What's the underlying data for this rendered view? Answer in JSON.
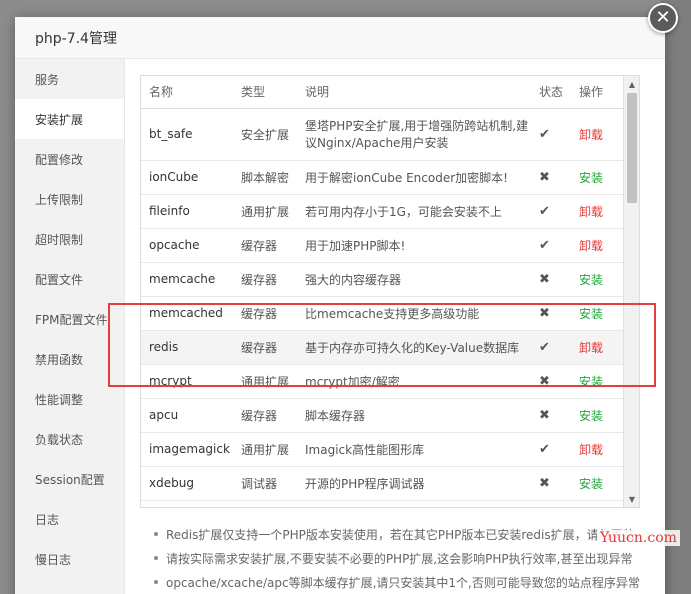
{
  "dialog": {
    "title": "php-7.4管理",
    "close_label": "✕"
  },
  "sidebar": {
    "items": [
      {
        "label": "服务"
      },
      {
        "label": "安装扩展"
      },
      {
        "label": "配置修改"
      },
      {
        "label": "上传限制"
      },
      {
        "label": "超时限制"
      },
      {
        "label": "配置文件"
      },
      {
        "label": "FPM配置文件"
      },
      {
        "label": "禁用函数"
      },
      {
        "label": "性能调整"
      },
      {
        "label": "负载状态"
      },
      {
        "label": "Session配置"
      },
      {
        "label": "日志"
      },
      {
        "label": "慢日志"
      }
    ],
    "active_index": 1
  },
  "table": {
    "headers": {
      "name": "名称",
      "type": "类型",
      "desc": "说明",
      "status": "状态",
      "action": "操作"
    },
    "rows": [
      {
        "name": "bt_safe",
        "type": "安全扩展",
        "desc": "堡塔PHP安全扩展,用于增强防跨站机制,建议Nginx/Apache用户安装",
        "status": "✔",
        "action": "卸载"
      },
      {
        "name": "ionCube",
        "type": "脚本解密",
        "desc": "用于解密ionCube Encoder加密脚本!",
        "status": "✖",
        "action": "安装"
      },
      {
        "name": "fileinfo",
        "type": "通用扩展",
        "desc": "若可用内存小于1G，可能会安装不上",
        "status": "✔",
        "action": "卸载"
      },
      {
        "name": "opcache",
        "type": "缓存器",
        "desc": "用于加速PHP脚本!",
        "status": "✔",
        "action": "卸载"
      },
      {
        "name": "memcache",
        "type": "缓存器",
        "desc": "强大的内容缓存器",
        "status": "✖",
        "action": "安装"
      },
      {
        "name": "memcached",
        "type": "缓存器",
        "desc": "比memcache支持更多高级功能",
        "status": "✖",
        "action": "安装"
      },
      {
        "name": "redis",
        "type": "缓存器",
        "desc": "基于内存亦可持久化的Key-Value数据库",
        "status": "✔",
        "action": "卸载"
      },
      {
        "name": "mcrypt",
        "type": "通用扩展",
        "desc": "mcrypt加密/解密",
        "status": "✖",
        "action": "安装"
      },
      {
        "name": "apcu",
        "type": "缓存器",
        "desc": "脚本缓存器",
        "status": "✖",
        "action": "安装"
      },
      {
        "name": "imagemagick",
        "type": "通用扩展",
        "desc": "Imagick高性能图形库",
        "status": "✔",
        "action": "卸载"
      },
      {
        "name": "xdebug",
        "type": "调试器",
        "desc": "开源的PHP程序调试器",
        "status": "✖",
        "action": "安装"
      }
    ]
  },
  "notes": [
    "Redis扩展仅支持一个PHP版本安装使用，若在其它PHP版本已安装redis扩展，请勿再装",
    "请按实际需求安装扩展,不要安装不必要的PHP扩展,这会影响PHP执行效率,甚至出现异常",
    "opcache/xcache/apc等脚本缓存扩展,请只安装其中1个,否则可能导致您的站点程序异常"
  ],
  "scrollbar": {
    "up_icon": "▲",
    "down_icon": "▼"
  },
  "watermark": "Yuucn.com",
  "colors": {
    "install": "#20a53a",
    "uninstall": "#e53935",
    "highlight_box": "#e0413f"
  }
}
